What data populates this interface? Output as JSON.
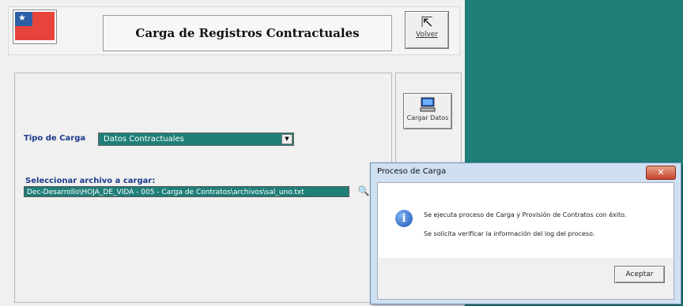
{
  "window": {
    "title": "Carga de Registros Contractuales"
  },
  "toolbar": {
    "volver_label": "Volver",
    "cargar_label": "Cargar Datos"
  },
  "form": {
    "tipo_label": "Tipo de Carga",
    "tipo_value": "Datos Contractuales",
    "archivo_label": "Seleccionar archivo a cargar:",
    "archivo_value": "Dec-Desarrollo\\HOJA_DE_VIDA - 005 - Carga de Contratos\\archivos\\sal_uno.txt"
  },
  "dialog": {
    "title": "Proceso de Carga",
    "close_glyph": "✕",
    "message_line1": "Se ejecuta proceso de Carga y Provisión de Contratos con éxito.",
    "message_line2": "Se solicita verificar la información del log del proceso.",
    "accept_label": "Aceptar"
  },
  "colors": {
    "accent_teal": "#1f7f78",
    "label_blue": "#1a3a8a"
  }
}
